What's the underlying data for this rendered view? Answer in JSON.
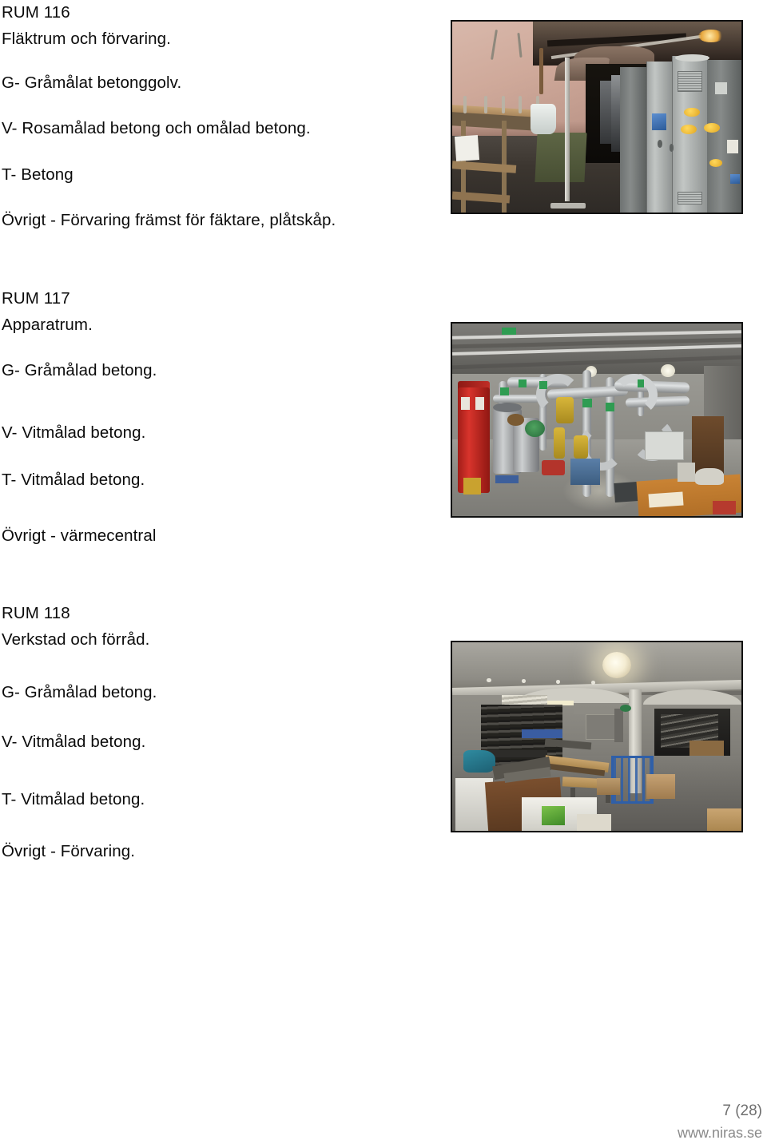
{
  "document": {
    "type": "inspection-report-page",
    "language": "sv"
  },
  "rooms": [
    {
      "id": "rum-116",
      "title": "RUM 116",
      "name": "Fläktrum och förvaring.",
      "golv": "G- Gråmålat betonggolv.",
      "vagg": "V- Rosamålad betong och omålad betong.",
      "tak": "T- Betong",
      "ovrigt": "Övrigt - Förvaring främst för fäktare, plåtskåp.",
      "photo_alt": "Mörkt fläktrum med plåtskåp, hyllor och rosamålade betongväggar."
    },
    {
      "id": "rum-117",
      "title": "RUM 117",
      "name": "Apparatrum.",
      "golv": "G- Gråmålad betong.",
      "vagg": "V- Vitmålad betong.",
      "tak": "T- Vitmålad betong.",
      "ovrigt": "Övrigt - värmecentral",
      "photo_alt": "Värmecentral med grå rörinstallationer, gröna markeringsband och röd tank."
    },
    {
      "id": "rum-118",
      "title": "RUM 118",
      "name": "Verkstad och förråd.",
      "golv": "G- Gråmålad betong.",
      "vagg": "V- Vitmålad betong.",
      "tak": "T- Vitmålad betong.",
      "ovrigt": "Övrigt - Förvaring.",
      "photo_alt": "Verkstad och förråd med staplade bord, bänkar och kartonger under taklampa."
    }
  ],
  "footer": {
    "page_number": "7 (28)",
    "url": "www.niras.se"
  },
  "colors": {
    "text": "#0b0b0b",
    "footer_text": "#6f6f6f",
    "footer_url": "#8a8a8a",
    "photo_border": "#111111",
    "background": "#ffffff"
  }
}
